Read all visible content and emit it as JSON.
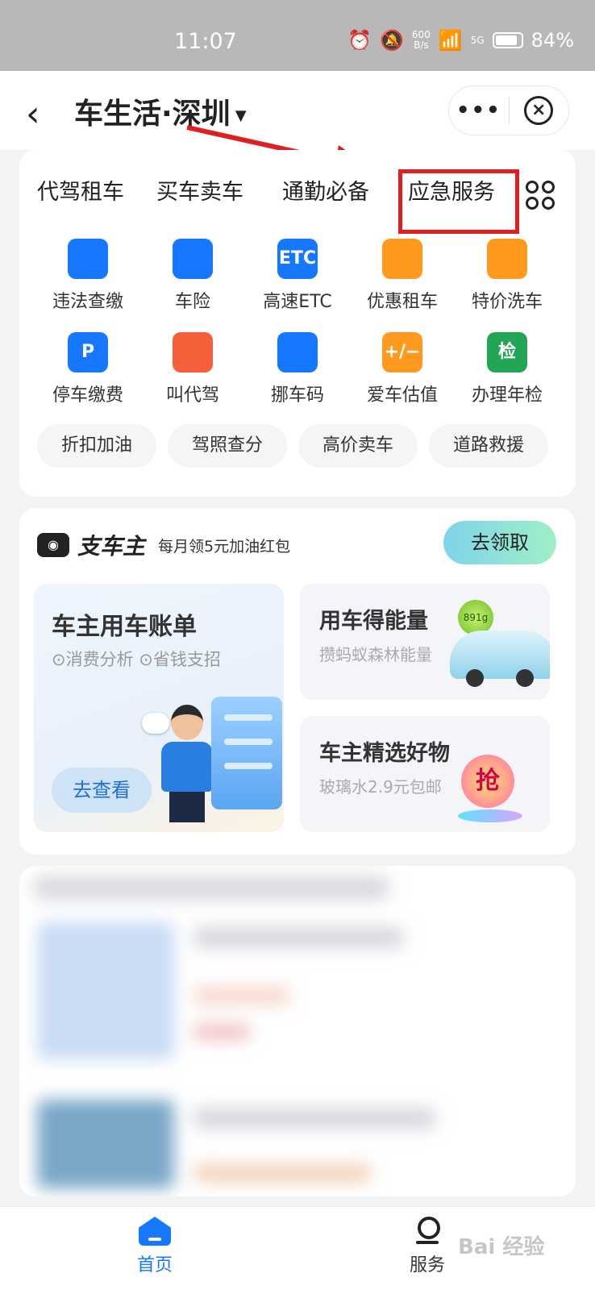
{
  "status_bar": {
    "time": "11:07",
    "net_speed_value": "600",
    "net_speed_unit": "B/s",
    "signal": "5G",
    "battery": "84%"
  },
  "header": {
    "title": "车生活·深圳",
    "more": "•••"
  },
  "tabs": [
    "代驾租车",
    "买车卖车",
    "通勤必备",
    "应急服务"
  ],
  "services": [
    {
      "label": "违法查缴",
      "icon": "camera-icon",
      "color": "#1677ff"
    },
    {
      "label": "车险",
      "icon": "shield-check-icon",
      "color": "#1677ff"
    },
    {
      "label": "高速ETC",
      "icon": "etc-icon",
      "icon_text": "ETC",
      "color": "#1677ff"
    },
    {
      "label": "优惠租车",
      "icon": "rental-car-icon",
      "color": "#ff9a1f"
    },
    {
      "label": "特价洗车",
      "icon": "car-wash-icon",
      "color": "#ff9a1f"
    },
    {
      "label": "停车缴费",
      "icon": "parking-icon",
      "icon_text": "P",
      "color": "#1677ff"
    },
    {
      "label": "叫代驾",
      "icon": "driver-icon",
      "color": "#f3603a"
    },
    {
      "label": "挪车码",
      "icon": "move-car-icon",
      "color": "#1677ff"
    },
    {
      "label": "爱车估值",
      "icon": "valuation-icon",
      "icon_text": "+/−",
      "color": "#ff9a1f"
    },
    {
      "label": "办理年检",
      "icon": "inspection-icon",
      "icon_text": "检",
      "color": "#22a656"
    }
  ],
  "chips": [
    "折扣加油",
    "驾照查分",
    "高价卖车",
    "道路救援"
  ],
  "promo": {
    "brand": "支车主",
    "slogan": "每月领5元加油红包",
    "claim_button": "去领取",
    "bill": {
      "title": "车主用车账单",
      "subtitle": "⊙消费分析 ⊙省钱支招",
      "button": "去查看"
    },
    "energy": {
      "title": "用车得能量",
      "subtitle": "攒蚂蚁森林能量",
      "badge": "891g"
    },
    "shop": {
      "title": "车主精选好物",
      "subtitle": "玻璃水2.9元包邮",
      "badge": "抢"
    }
  },
  "tabbar": {
    "home": "首页",
    "service": "服务"
  },
  "watermark": "Bai 经验"
}
